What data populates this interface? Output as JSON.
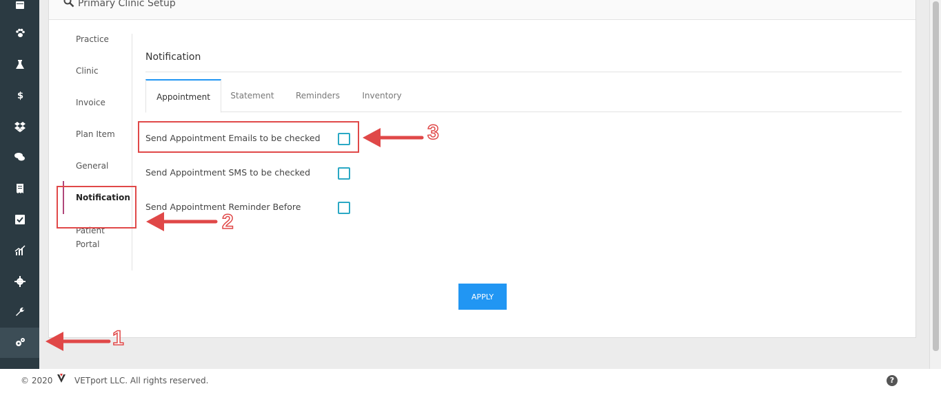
{
  "panel": {
    "title": "Primary Clinic Setup"
  },
  "subnav": {
    "items": [
      {
        "label": "Practice"
      },
      {
        "label": "Clinic"
      },
      {
        "label": "Invoice"
      },
      {
        "label": "Plan Item"
      },
      {
        "label": "General"
      },
      {
        "label": "Notification"
      },
      {
        "label": "Patient Portal"
      }
    ],
    "active": "Notification"
  },
  "section": {
    "title": "Notification"
  },
  "tabs": [
    {
      "label": "Appointment"
    },
    {
      "label": "Statement"
    },
    {
      "label": "Reminders"
    },
    {
      "label": "Inventory"
    }
  ],
  "active_tab": "Appointment",
  "options": [
    {
      "label": "Send Appointment Emails to be checked",
      "checked": false
    },
    {
      "label": "Send Appointment SMS to be checked",
      "checked": false
    },
    {
      "label": "Send Appointment Reminder Before",
      "checked": false
    }
  ],
  "apply_label": "APPLY",
  "annotations": {
    "one": "1",
    "two": "2",
    "three": "3"
  },
  "footer": {
    "copyright_prefix": "© 2020",
    "copyright_text": "VETport LLC. All rights reserved.",
    "help": "?"
  },
  "colors": {
    "accent": "#2196f3",
    "sidebar": "#2b3a42",
    "annotation": "#e04848",
    "checkbox": "#2aa8c4",
    "active_marker": "#b0477a"
  },
  "sidebar_icons": [
    "calendar-icon",
    "paw-icon",
    "flask-icon",
    "dollar-icon",
    "dropbox-icon",
    "chat-icon",
    "receipt-icon",
    "checkbox-icon",
    "chart-icon",
    "gear-icon",
    "wrench-icon",
    "cogs-icon"
  ]
}
